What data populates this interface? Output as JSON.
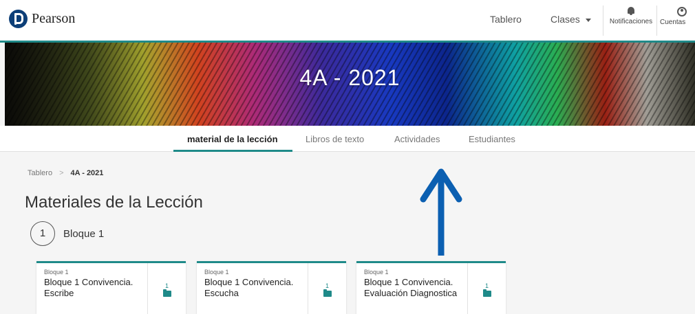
{
  "header": {
    "logo_text": "Pearson",
    "nav": {
      "tablero": "Tablero",
      "clases": "Clases"
    },
    "notifications_label": "Notificaciones",
    "account_label": "Cuentas"
  },
  "banner": {
    "title": "4A - 2021"
  },
  "tabs": [
    {
      "label": "material de la lección",
      "active": true
    },
    {
      "label": "Libros de texto",
      "active": false
    },
    {
      "label": "Actividades",
      "active": false
    },
    {
      "label": "Estudiantes",
      "active": false
    }
  ],
  "breadcrumb": {
    "root": "Tablero",
    "separator": ">",
    "current": "4A - 2021"
  },
  "page_title": "Materiales de la Lección",
  "block": {
    "number": "1",
    "label": "Bloque 1"
  },
  "cards": [
    {
      "category": "Bloque 1",
      "title_line1": "Bloque 1 Convivencia.",
      "title_line2": "Escribe",
      "count": "1"
    },
    {
      "category": "Bloque 1",
      "title_line1": "Bloque 1 Convivencia.",
      "title_line2": "Escucha",
      "count": "1"
    },
    {
      "category": "Bloque 1",
      "title_line1": "Bloque 1 Convivencia.",
      "title_line2": "Evaluación Diagnostica",
      "count": "1"
    }
  ],
  "colors": {
    "accent": "#1f8a89",
    "arrow": "#0b5fb1",
    "logo": "#0d3f78"
  },
  "icons": [
    "pearson-logo-icon",
    "bell-icon",
    "user-icon",
    "chevron-down-icon",
    "folder-icon",
    "arrow-up-icon"
  ]
}
